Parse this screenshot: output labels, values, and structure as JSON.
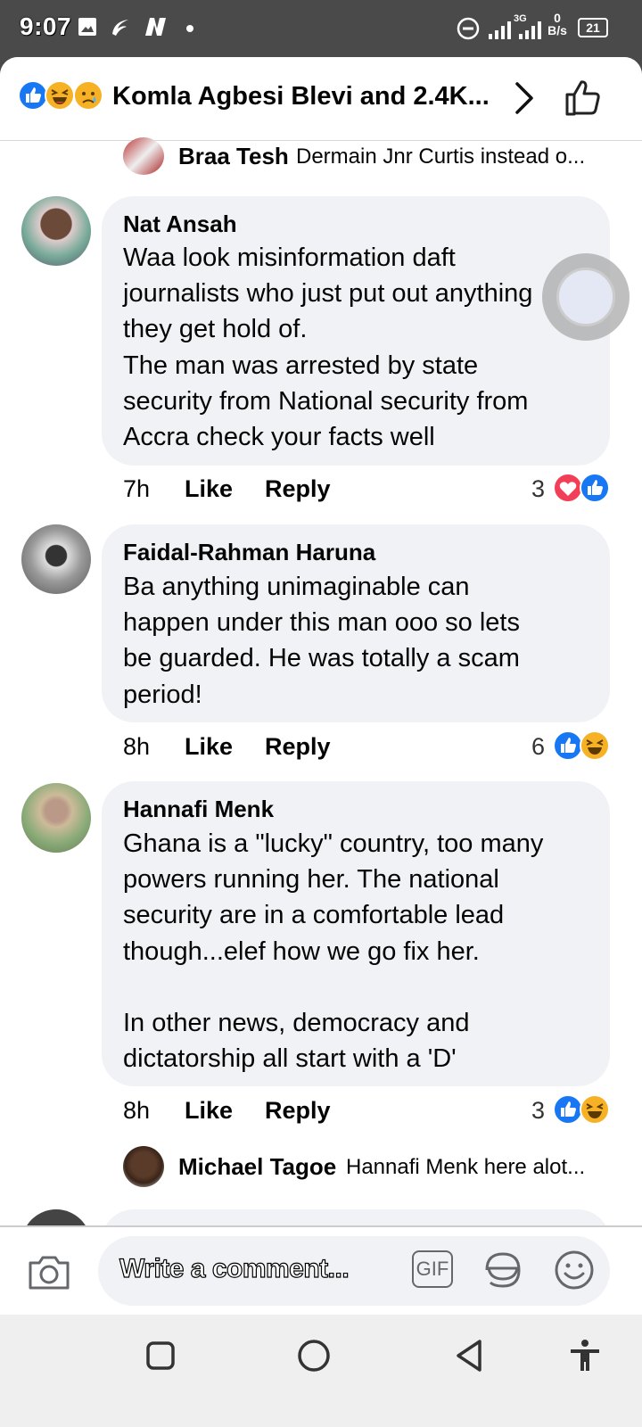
{
  "status_bar": {
    "time": "9:07",
    "network_label": "3G",
    "data_speed_value": "0",
    "data_speed_unit": "B/s",
    "battery": "21"
  },
  "header": {
    "title": "Komla Agbesi Blevi and 2.4K...",
    "reaction_icons": [
      "like-icon",
      "haha-icon",
      "sad-icon"
    ]
  },
  "comments": [
    {
      "name": "Braa Tesh",
      "snippet": "Dermain Jnr Curtis instead o..."
    },
    {
      "name": "Nat Ansah",
      "text": "Waa look misinformation daft\njournalists who just put out anything\nthey get hold of.\nThe man was arrested by state\nsecurity from National security from\nAccra check your facts well",
      "time": "7h",
      "like": "Like",
      "reply": "Reply",
      "reaction_count": "3",
      "reactions": [
        "love-icon",
        "like-icon"
      ]
    },
    {
      "name": "Faidal-Rahman Haruna",
      "text": "Ba anything unimaginable can\nhappen under this man ooo so lets\nbe guarded. He was totally a scam\nperiod!",
      "time": "8h",
      "like": "Like",
      "reply": "Reply",
      "reaction_count": "6",
      "reactions": [
        "like-icon",
        "haha-icon"
      ]
    },
    {
      "name": "Hannafi Menk",
      "text": "Ghana is a \"lucky\" country, too many\npowers running  her. The national\nsecurity are in a comfortable lead\nthough...elef how we go fix her.\n\nIn other news, democracy and\ndictatorship all start with a 'D'",
      "time": "8h",
      "like": "Like",
      "reply": "Reply",
      "reaction_count": "3",
      "reactions": [
        "like-icon",
        "haha-icon"
      ]
    },
    {
      "name": "Michael Tagoe",
      "snippet": "Hannafi Menk here alot..."
    }
  ],
  "composer": {
    "placeholder": "Write a comment...",
    "gif_label": "GIF"
  },
  "colors": {
    "fb_blue": "#1877f2",
    "love_red": "#f33e58",
    "haha_yellow": "#f7b125",
    "bubble_bg": "#f0f2f5"
  }
}
